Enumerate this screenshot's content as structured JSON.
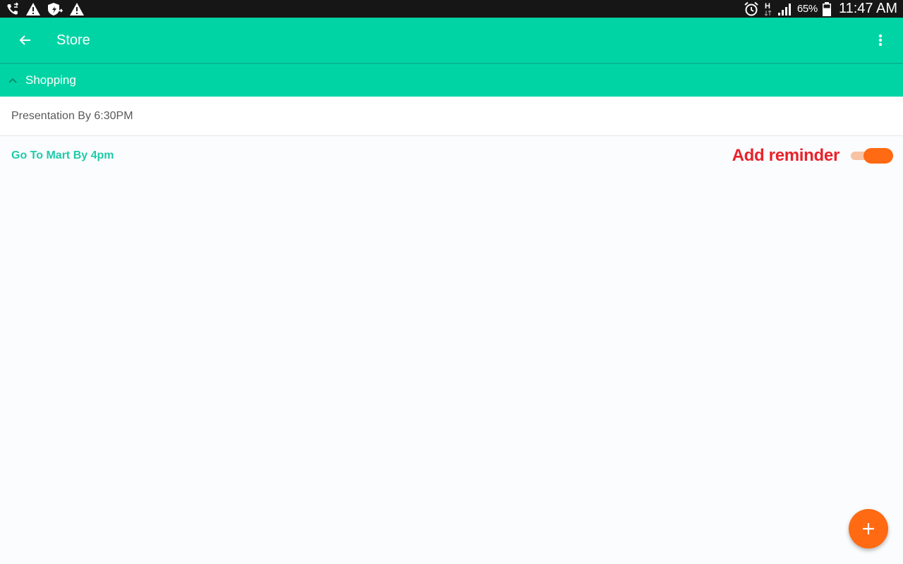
{
  "status_bar": {
    "left_icons": [
      "call-forward-icon",
      "warning-icon",
      "shield-icon",
      "warning-icon"
    ],
    "right_icons": [
      "alarm-icon",
      "network-h-icon",
      "signal-icon",
      "battery-icon"
    ],
    "network_type": "H",
    "battery_percent": "65%",
    "time": "11:47 AM"
  },
  "app_bar": {
    "back_icon": "arrow-back-icon",
    "title": "Store",
    "overflow_icon": "more-vert-icon"
  },
  "section": {
    "icon": "chevron-up-icon",
    "title": "Shopping"
  },
  "tasks": [
    {
      "text": "Presentation By 6:30PM"
    },
    {
      "text": "Go To Mart By 4pm",
      "reminder_label": "Add reminder",
      "reminder_on": true
    }
  ],
  "fab": {
    "icon": "plus-icon"
  },
  "colors": {
    "primary": "#00d4a4",
    "accent": "#ff6a12",
    "annotation": "#e8222a",
    "active_task": "#1fcba8"
  }
}
